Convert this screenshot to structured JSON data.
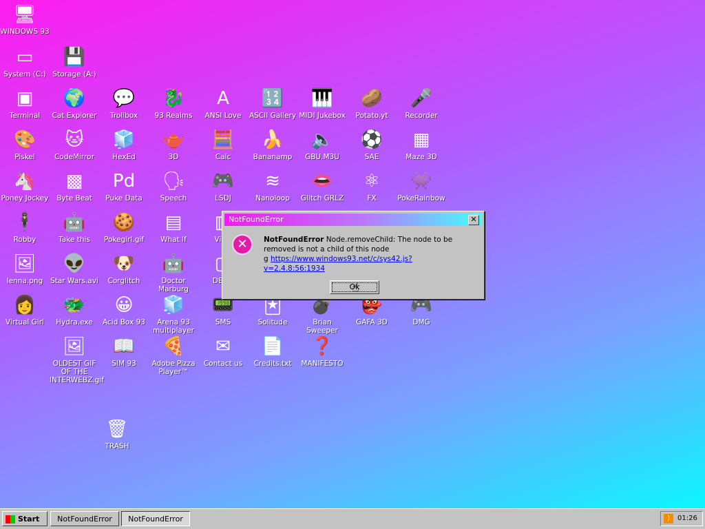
{
  "desktop": {
    "icons": [
      {
        "label": "WINDOWS 93",
        "glyph": "🖥"
      },
      {
        "label": "System (C:)",
        "glyph": "▭"
      },
      {
        "label": "Storage (A:)",
        "glyph": "💾"
      },
      {
        "label": "Terminal",
        "glyph": "▣"
      },
      {
        "label": "Cat Explorer",
        "glyph": "🌍"
      },
      {
        "label": "Trollbox",
        "glyph": "💬"
      },
      {
        "label": "93 Realms",
        "glyph": "🐉"
      },
      {
        "label": "ANSI Love",
        "glyph": "A"
      },
      {
        "label": "ASCII Gallery",
        "glyph": "🔢"
      },
      {
        "label": "MIDI Jukebox",
        "glyph": "🎹"
      },
      {
        "label": "Potato.yt",
        "glyph": "🥔"
      },
      {
        "label": "Recorder",
        "glyph": "🎤"
      },
      {
        "label": "Piskel",
        "glyph": "🎨"
      },
      {
        "label": "CodeMirror",
        "glyph": "🐱"
      },
      {
        "label": "HexEd",
        "glyph": "🧊"
      },
      {
        "label": "3D",
        "glyph": "🫖"
      },
      {
        "label": "Calc",
        "glyph": "🧮"
      },
      {
        "label": "Bananamp",
        "glyph": "🍌"
      },
      {
        "label": "GBU.M3U",
        "glyph": "🔈"
      },
      {
        "label": "SAE",
        "glyph": "⚽"
      },
      {
        "label": "Maze 3D",
        "glyph": "▦"
      },
      {
        "label": "Poney Jockey",
        "glyph": "🦄"
      },
      {
        "label": "Byte Beat",
        "glyph": "▩"
      },
      {
        "label": "Puke Data",
        "glyph": "Pd"
      },
      {
        "label": "Speech",
        "glyph": "🗣"
      },
      {
        "label": "LSDJ",
        "glyph": "🎮"
      },
      {
        "label": "Nanoloop",
        "glyph": "≋"
      },
      {
        "label": "Glitch GRLZ",
        "glyph": "👄"
      },
      {
        "label": "FX",
        "glyph": "⚛"
      },
      {
        "label": "PokeRainbow",
        "glyph": "👾"
      },
      {
        "label": "Robby",
        "glyph": "🕴"
      },
      {
        "label": "Take this",
        "glyph": "🤖"
      },
      {
        "label": "Pokegirl.gif",
        "glyph": "🍪"
      },
      {
        "label": "What If",
        "glyph": "▤"
      },
      {
        "label": "Virtu",
        "glyph": "▥"
      },
      {
        "label": "lenna.png",
        "glyph": "🖼"
      },
      {
        "label": "Star Wars.avi",
        "glyph": "👽"
      },
      {
        "label": "Corglitch",
        "glyph": "🐶"
      },
      {
        "label": "Doctor Marburg",
        "glyph": "🤖"
      },
      {
        "label": "DERG",
        "glyph": "▢"
      },
      {
        "label": "Virtual Girl",
        "glyph": "👩"
      },
      {
        "label": "Hydra.exe",
        "glyph": "🐲"
      },
      {
        "label": "Acid Box 93",
        "glyph": "😀"
      },
      {
        "label": "Arena 93 multiplayer",
        "glyph": "🧊"
      },
      {
        "label": "SMS",
        "glyph": "📟"
      },
      {
        "label": "Solitude",
        "glyph": "🃏"
      },
      {
        "label": "Brian Sweeper",
        "glyph": "💣"
      },
      {
        "label": "GAFA 3D",
        "glyph": "👺"
      },
      {
        "label": "DMG",
        "glyph": "🎮"
      },
      {
        "label": "OLDEST GIF OF THE INTERWEBZ.gif",
        "glyph": "🖼"
      },
      {
        "label": "SIM 93",
        "glyph": "📖"
      },
      {
        "label": "Adobe Pizza Player™",
        "glyph": "🍕"
      },
      {
        "label": "Contact us",
        "glyph": "✉"
      },
      {
        "label": "Credits.txt",
        "glyph": "📄"
      },
      {
        "label": "MANIFESTO",
        "glyph": "❓"
      },
      {
        "label": "TRASH",
        "glyph": "🗑"
      }
    ]
  },
  "dialog": {
    "title": "NotFoundError",
    "close_label": "✕",
    "error_name": "NotFoundError",
    "message": " Node.removeChild: The node to be removed is not a child of this node",
    "line_prefix": "g ",
    "link": "https://www.windows93.net/c/sys42.js?v=2.4.8:56:1934",
    "ok_label": "Ok"
  },
  "taskbar": {
    "start_label": "Start",
    "tasks": [
      {
        "label": "NotFoundError"
      },
      {
        "label": "NotFoundError"
      }
    ],
    "clock": "01:26"
  }
}
